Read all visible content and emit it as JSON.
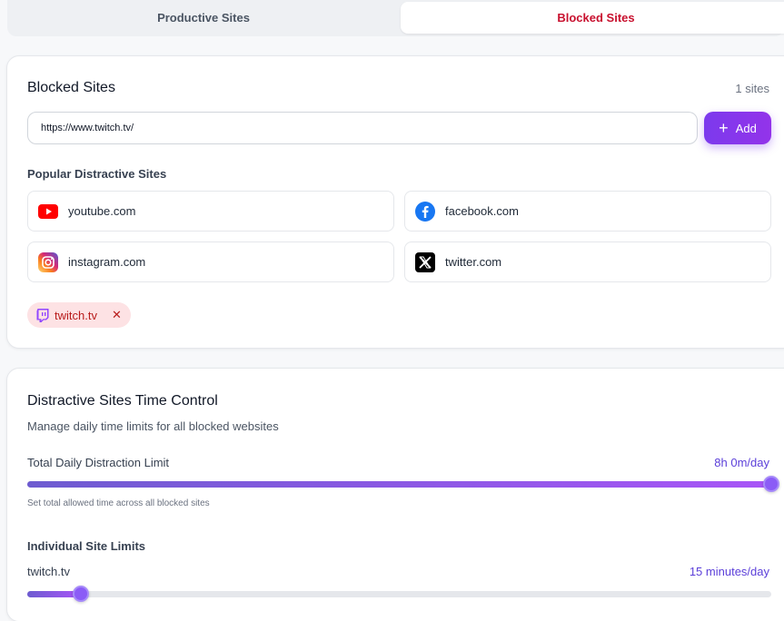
{
  "tabs": [
    {
      "label": "Productive Sites",
      "active": false
    },
    {
      "label": "Blocked Sites",
      "active": true
    }
  ],
  "blocked": {
    "title": "Blocked Sites",
    "count": "1 sites",
    "input_value": "https://www.twitch.tv/",
    "add_label": "Add",
    "popular_title": "Popular Distractive Sites",
    "popular": [
      {
        "label": "youtube.com",
        "icon": "youtube-icon"
      },
      {
        "label": "facebook.com",
        "icon": "facebook-icon"
      },
      {
        "label": "instagram.com",
        "icon": "instagram-icon"
      },
      {
        "label": "twitter.com",
        "icon": "x-twitter-icon"
      }
    ],
    "chips": [
      {
        "label": "twitch.tv",
        "icon": "twitch-icon",
        "remove": "✕"
      }
    ]
  },
  "time_control": {
    "title": "Distractive Sites Time Control",
    "description": "Manage daily time limits for all blocked websites",
    "total_label": "Total Daily Distraction Limit",
    "total_value": "8h 0m/day",
    "total_fraction": 1.0,
    "total_hint": "Set total allowed time across all blocked sites",
    "individual_title": "Individual Site Limits",
    "sites": [
      {
        "label": "twitch.tv",
        "value": "15 minutes/day",
        "fraction": 0.072
      }
    ]
  },
  "colors": {
    "accent": "#7c3aed",
    "blocked_tab": "#c8102e",
    "chip_bg": "#fde2e4"
  }
}
